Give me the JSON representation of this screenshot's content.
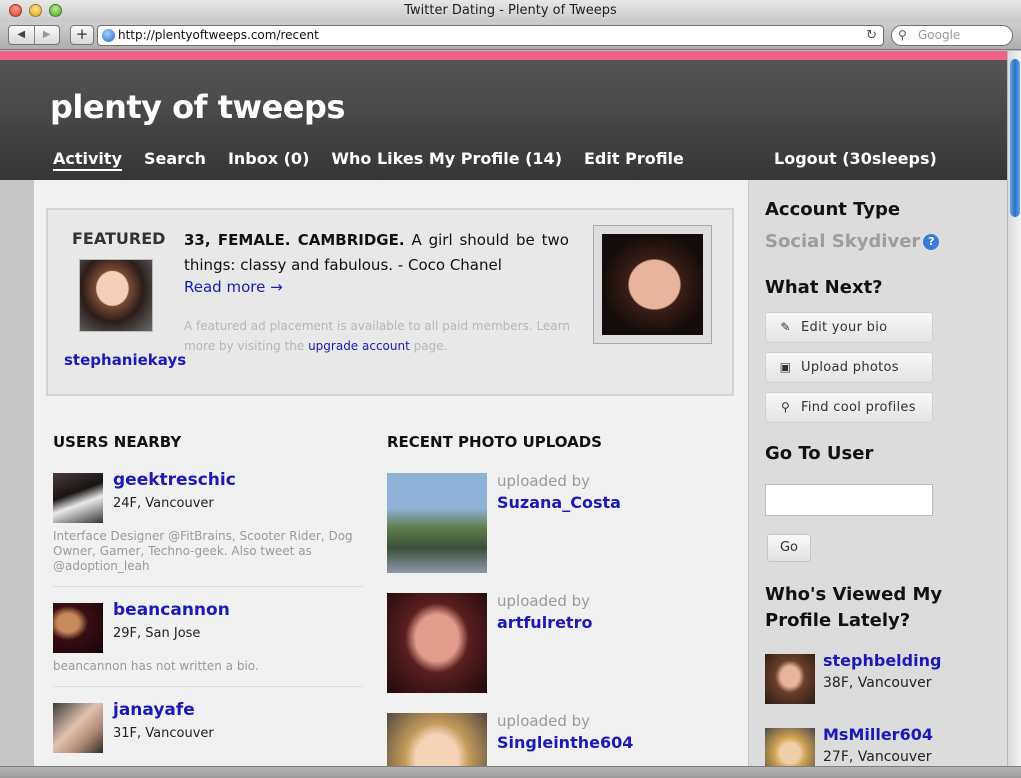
{
  "browser": {
    "window_title": "Twitter Dating - Plenty of Tweeps",
    "url": "http://plentyoftweeps.com/recent",
    "search_placeholder": "Google"
  },
  "site": {
    "logo": "plenty of tweeps",
    "nav": [
      "Activity",
      "Search",
      "Inbox (0)",
      "Who Likes My Profile (14)",
      "Edit Profile"
    ],
    "active_nav": "Activity",
    "logout": "Logout (30sleeps)"
  },
  "featured": {
    "label": "FEATURED",
    "username": "stephaniekays",
    "headline": "33, FEMALE. CAMBRIDGE.",
    "text": "A girl should be two things: classy and fabulous. - Coco Chanel",
    "read_more": "Read more →",
    "note_before": "A featured ad placement is available to all paid members. Learn more by visiting the",
    "note_link": "upgrade account",
    "note_after": "page."
  },
  "users_nearby": {
    "title": "USERS NEARBY",
    "users": [
      {
        "name": "geektreschic",
        "meta": "24F, Vancouver",
        "bio": "Interface Designer @FitBrains, Scooter Rider, Dog Owner, Gamer, Techno-geek. Also tweet as @adoption_leah"
      },
      {
        "name": "beancannon",
        "meta": "29F, San Jose",
        "bio": "beancannon has not written a bio."
      },
      {
        "name": "janayafe",
        "meta": "31F, Vancouver",
        "bio": ""
      }
    ]
  },
  "recent_uploads": {
    "title": "RECENT PHOTO UPLOADS",
    "uploaded_by": "uploaded by",
    "uploads": [
      {
        "user": "Suzana_Costa"
      },
      {
        "user": "artfulretro"
      },
      {
        "user": "Singleinthe604"
      }
    ]
  },
  "sidebar": {
    "account_type_title": "Account Type",
    "account_type": "Social Skydiver",
    "what_next_title": "What Next?",
    "actions": [
      {
        "label": "Edit your bio",
        "icon": "pencil-icon"
      },
      {
        "label": "Upload photos",
        "icon": "photo-icon"
      },
      {
        "label": "Find cool profiles",
        "icon": "magnifier-icon"
      }
    ],
    "go_to_user_title": "Go To User",
    "go_button": "Go",
    "viewed_title": "Who's Viewed My Profile Lately?",
    "viewers": [
      {
        "name": "stephbelding",
        "meta": "38F, Vancouver"
      },
      {
        "name": "MsMiller604",
        "meta": "27F, Vancouver"
      }
    ]
  }
}
